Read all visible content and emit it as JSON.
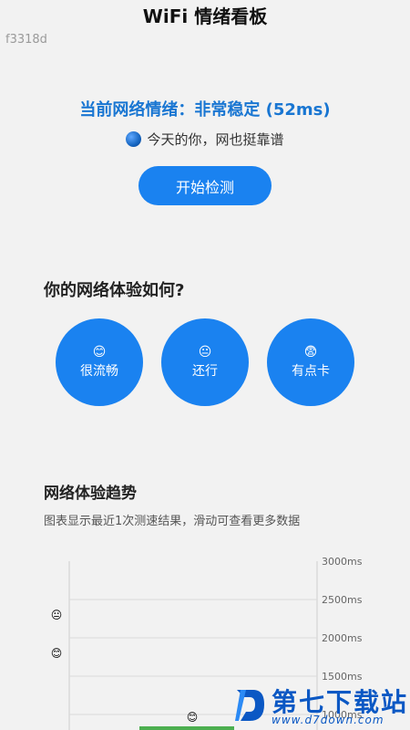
{
  "header": {
    "title": "WiFi 情绪看板",
    "device_id": "f3318d"
  },
  "status": {
    "text": "当前网络情绪：非常稳定 (52ms)",
    "subtitle": "今天的你，网也挺靠谱",
    "button_label": "开始检测"
  },
  "feedback": {
    "question": "你的网络体验如何?",
    "options": [
      {
        "emoji": "😊",
        "label": "很流畅"
      },
      {
        "emoji": "😐",
        "label": "还行"
      },
      {
        "emoji": "😨",
        "label": "有点卡"
      }
    ]
  },
  "trend": {
    "title": "网络体验趋势",
    "subtitle": "图表显示最近1次测速结果，滑动可查看更多数据"
  },
  "chart_data": {
    "type": "bar",
    "title": "",
    "xlabel": "",
    "ylabel": "",
    "ylim": [
      1000,
      3000
    ],
    "y_ticks": [
      "3000ms",
      "2500ms",
      "2000ms",
      "1500ms",
      "1000ms"
    ],
    "y_tick_values": [
      3000,
      2500,
      2000,
      1500,
      1000
    ],
    "grid": true,
    "emoji_markers": [
      {
        "emoji": "😐",
        "value": 2300
      },
      {
        "emoji": "😊",
        "value": 1800
      }
    ],
    "categories": [
      ""
    ],
    "values": [
      52
    ],
    "bar_emoji": "😊",
    "bar_color": "#4caf50"
  },
  "watermark": {
    "title": "第七下载站",
    "url": "www.d7down.com"
  },
  "colors": {
    "accent": "#1a82f0",
    "status_text": "#1976d2"
  }
}
